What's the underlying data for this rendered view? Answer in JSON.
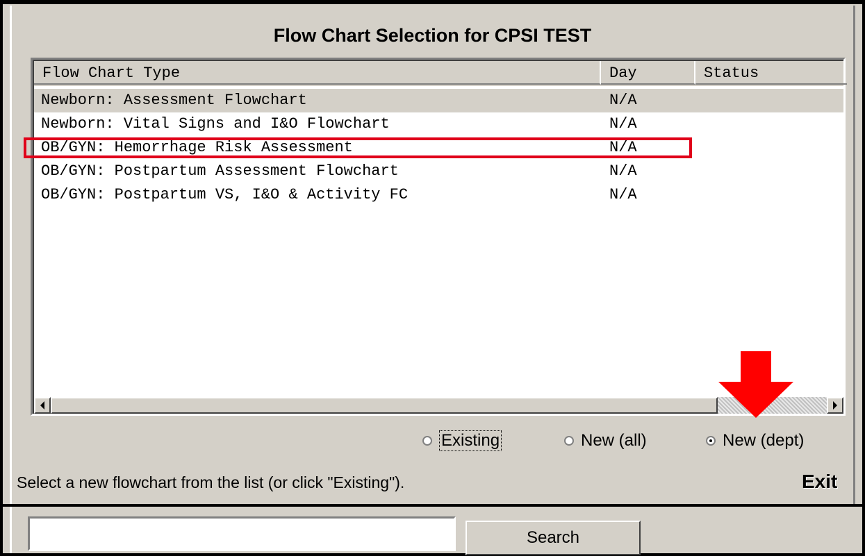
{
  "window": {
    "title": "Flow Chart Selection for CPSI TEST"
  },
  "list": {
    "columns": [
      {
        "label": "Flow Chart Type"
      },
      {
        "label": "Day"
      },
      {
        "label": "Status"
      }
    ],
    "rows": [
      {
        "type": "Newborn: Assessment Flowchart",
        "day": "N/A",
        "status": "",
        "selected": true
      },
      {
        "type": "Newborn: Vital Signs and I&O Flowchart",
        "day": "N/A",
        "status": ""
      },
      {
        "type": "OB/GYN: Hemorrhage Risk Assessment",
        "day": "N/A",
        "status": "",
        "highlighted": true
      },
      {
        "type": "OB/GYN: Postpartum Assessment Flowchart",
        "day": "N/A",
        "status": ""
      },
      {
        "type": "OB/GYN: Postpartum VS, I&O & Activity FC",
        "day": "N/A",
        "status": ""
      }
    ]
  },
  "filter": {
    "options": [
      {
        "label": "Existing",
        "checked": false
      },
      {
        "label": "New (all)",
        "checked": false
      },
      {
        "label": "New (dept)",
        "checked": true
      }
    ]
  },
  "message": "Select a new flowchart from the list (or click \"Existing\").",
  "exit_label": "Exit",
  "search": {
    "value": "",
    "button_label": "Search"
  },
  "annotations": {
    "highlight_color": "#e0001a",
    "arrow_color": "#ff0000",
    "arrow_icon": "arrow-down-icon"
  }
}
